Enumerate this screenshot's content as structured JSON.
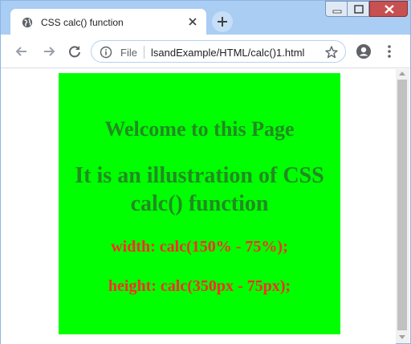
{
  "tab": {
    "title": "CSS calc() function",
    "favicon": "globe-icon",
    "close": "close-icon"
  },
  "window_controls": [
    "minimize-icon",
    "maximize-icon",
    "close-icon"
  ],
  "toolbar": {
    "back": "back-arrow-icon",
    "forward": "forward-arrow-icon",
    "reload": "reload-icon",
    "new_tab": "plus-icon",
    "star": "star-icon",
    "profile": "account-icon",
    "menu": "kebab-menu-icon"
  },
  "omnibox": {
    "info_icon": "info-icon",
    "scheme_label": "File",
    "url": "lsandExample/HTML/calc()1.html"
  },
  "page": {
    "heading1": "Welcome to this Page",
    "heading2": "It is an illustration of CSS calc() function",
    "line1": "width: calc(150% - 75%);",
    "line2": "height: calc(350px - 75px);",
    "box_color": "#00ff00",
    "heading_color": "#228b22",
    "text_color": "#ff2a2a"
  }
}
